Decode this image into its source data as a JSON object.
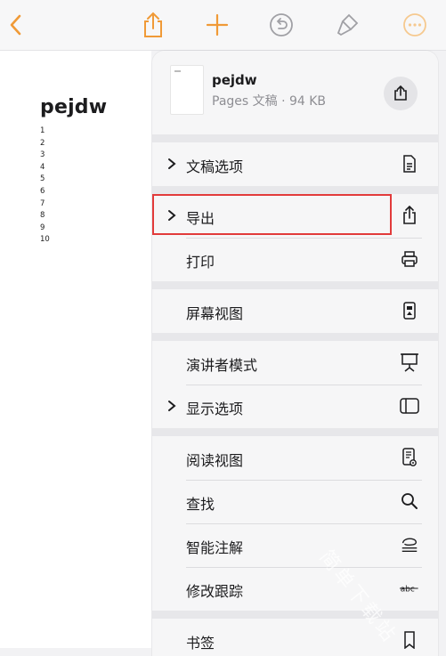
{
  "colors": {
    "accent": "#f09a37",
    "highlight": "#e23b3b"
  },
  "toolbar": {
    "icons": [
      "back-chevron-icon",
      "share-icon",
      "plus-icon",
      "undo-icon",
      "paintbrush-icon",
      "more-icon"
    ]
  },
  "document": {
    "title": "pejdw",
    "lines": [
      "1",
      "2",
      "3",
      "4",
      "5",
      "6",
      "7",
      "8",
      "9",
      "10"
    ]
  },
  "menu": {
    "file_name": "pejdw",
    "file_meta": "Pages 文稿 · 94 KB",
    "items": {
      "doc_options": "文稿选项",
      "export": "导出",
      "print": "打印",
      "screen_view": "屏幕视图",
      "presenter_mode": "演讲者模式",
      "display_options": "显示选项",
      "reading_view": "阅读视图",
      "find": "查找",
      "smart_annotation": "智能注解",
      "track_changes": "修改跟踪",
      "bookmarks": "书签"
    }
  },
  "watermark": "简单下载站"
}
